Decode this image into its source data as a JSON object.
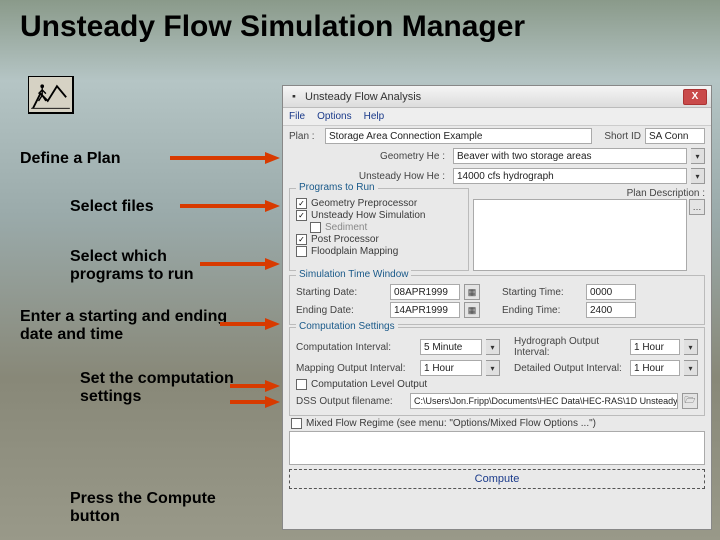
{
  "slide": {
    "title": "Unsteady Flow Simulation Manager",
    "labels": {
      "define_plan": "Define a Plan",
      "select_files": "Select files",
      "select_programs": "Select which programs to run",
      "enter_dates": "Enter a starting and ending date and time",
      "set_comp": "Set the computation settings",
      "press_compute": "Press the Compute button"
    }
  },
  "dialog": {
    "title": "Unsteady Flow Analysis",
    "close": "X",
    "menu": {
      "file": "File",
      "options": "Options",
      "help": "Help"
    },
    "plan_section": {
      "plan_lbl": "Plan :",
      "plan_val": "Storage Area Connection Example",
      "shortid_lbl": "Short ID",
      "shortid_val": "SA Conn"
    },
    "files": {
      "geom_lbl": "Geometry He :",
      "geom_val": "Beaver with two storage areas",
      "flow_lbl": "Unsteady How He :",
      "flow_val": "14000 cfs hydrograph"
    },
    "plan_desc_lbl": "Plan Description :",
    "programs": {
      "group": "Programs to Run",
      "geom_pre": "Geometry Preprocessor",
      "unsteady": "Unsteady How Simulation",
      "sediment": "Sediment",
      "post": "Post Processor",
      "floodplain": "Floodplain Mapping"
    },
    "time_window": {
      "group": "Simulation Time Window",
      "start_date_lbl": "Starting Date:",
      "start_date_val": "08APR1999",
      "start_time_lbl": "Starting Time:",
      "start_time_val": "0000",
      "end_date_lbl": "Ending Date:",
      "end_date_val": "14APR1999",
      "end_time_lbl": "Ending Time:",
      "end_time_val": "2400"
    },
    "comp": {
      "group": "Computation Settings",
      "comp_int_lbl": "Computation Interval:",
      "comp_int_val": "5 Minute",
      "hydro_int_lbl": "Hydrograph Output Interval:",
      "hydro_int_val": "1 Hour",
      "map_int_lbl": "Mapping Output Interval:",
      "map_int_val": "1 Hour",
      "det_int_lbl": "Detailed Output Interval:",
      "det_int_val": "1 Hour",
      "level_output": "Computation Level Output",
      "dss_lbl": "DSS Output filename:",
      "dss_val": "C:\\Users\\Jon.Fripp\\Documents\\HEC Data\\HEC-RAS\\1D Unsteady",
      "mixed_flow": "Mixed Flow Regime (see menu: \"Options/Mixed Flow Options ...\")"
    },
    "compute_btn": "Compute"
  }
}
